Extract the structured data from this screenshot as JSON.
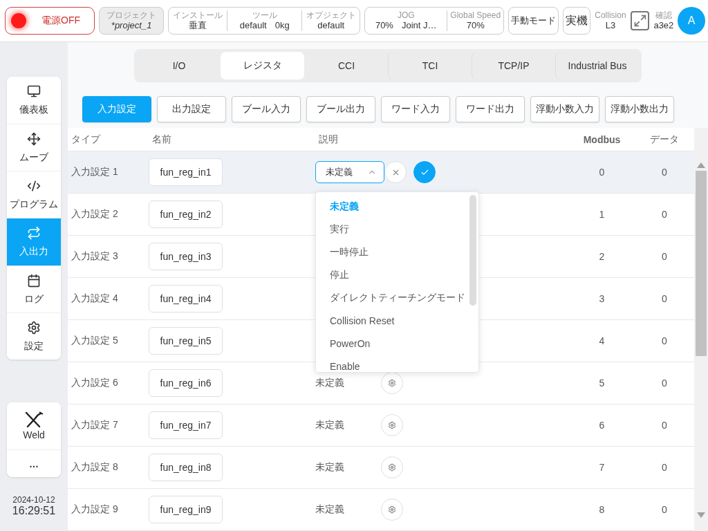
{
  "top_bar": {
    "power": {
      "label": "電源OFF",
      "on": false
    },
    "project": {
      "label": "プロジェクト",
      "value": "*project_1"
    },
    "setup": [
      {
        "label": "インストール",
        "values": [
          "垂直"
        ]
      },
      {
        "label": "ツール",
        "values": [
          "default",
          "0kg"
        ]
      },
      {
        "label": "オブジェクト",
        "values": [
          "default"
        ]
      }
    ],
    "speed": [
      {
        "label": "JOG",
        "values": [
          "70%",
          "Joint J…"
        ]
      },
      {
        "label": "Global Speed",
        "values": [
          "70%"
        ]
      }
    ],
    "buttons": [
      "手動モード",
      "実機"
    ],
    "collision": {
      "label": "Collision",
      "value": "L3"
    },
    "confirm": {
      "label": "確認",
      "value": "a3e2"
    },
    "avatar": "A"
  },
  "sidebar": {
    "items": [
      {
        "label": "儀表板",
        "selected": false
      },
      {
        "label": "ムーブ",
        "selected": false
      },
      {
        "label": "プログラム",
        "selected": false
      },
      {
        "label": "入出力",
        "selected": true
      },
      {
        "label": "ログ",
        "selected": false
      },
      {
        "label": "設定",
        "selected": false
      }
    ],
    "extras": [
      {
        "label": "Weld",
        "kind": "weld"
      },
      {
        "label": "…",
        "kind": "more"
      }
    ],
    "date": "2024-10-12",
    "time": "16:29:51"
  },
  "tabs": [
    {
      "label": "I/O",
      "selected": false
    },
    {
      "label": "レジスタ",
      "selected": true
    },
    {
      "label": "CCI",
      "selected": false
    },
    {
      "label": "TCI",
      "selected": false
    },
    {
      "label": "TCP/IP",
      "selected": false
    },
    {
      "label": "Industrial Bus",
      "selected": false
    }
  ],
  "sub_tabs": [
    {
      "label": "入力設定",
      "selected": true
    },
    {
      "label": "出力設定",
      "selected": false
    },
    {
      "label": "ブール入力",
      "selected": false
    },
    {
      "label": "ブール出力",
      "selected": false
    },
    {
      "label": "ワード入力",
      "selected": false
    },
    {
      "label": "ワード出力",
      "selected": false
    },
    {
      "label": "浮動小数入力",
      "selected": false
    },
    {
      "label": "浮動小数出力",
      "selected": false
    }
  ],
  "table": {
    "columns": [
      "タイプ",
      "名前",
      "説明",
      "Modbus",
      "データ"
    ],
    "rows": [
      {
        "type": "入力設定 1",
        "name": "fun_reg_in1",
        "description": "未定義",
        "selected": true,
        "modbus": "0",
        "data": "0"
      },
      {
        "type": "入力設定 2",
        "name": "fun_reg_in2",
        "selected": false,
        "modbus": "1",
        "data": "0"
      },
      {
        "type": "入力設定 3",
        "name": "fun_reg_in3",
        "selected": false,
        "modbus": "2",
        "data": "0"
      },
      {
        "type": "入力設定 4",
        "name": "fun_reg_in4",
        "selected": false,
        "modbus": "3",
        "data": "0"
      },
      {
        "type": "入力設定 5",
        "name": "fun_reg_in5",
        "selected": false,
        "modbus": "4",
        "data": "0"
      },
      {
        "type": "入力設定 6",
        "name": "fun_reg_in6",
        "description": "未定義",
        "selected": false,
        "modbus": "5",
        "data": "0"
      },
      {
        "type": "入力設定 7",
        "name": "fun_reg_in7",
        "description": "未定義",
        "selected": false,
        "modbus": "6",
        "data": "0"
      },
      {
        "type": "入力設定 8",
        "name": "fun_reg_in8",
        "description": "未定義",
        "selected": false,
        "modbus": "7",
        "data": "0"
      },
      {
        "type": "入力設定 9",
        "name": "fun_reg_in9",
        "description": "未定義",
        "selected": false,
        "modbus": "8",
        "data": "0"
      }
    ]
  },
  "dropdown": {
    "options": [
      {
        "label": "未定義",
        "selected": true
      },
      {
        "label": "実行",
        "selected": false
      },
      {
        "label": "一時停止",
        "selected": false
      },
      {
        "label": "停止",
        "selected": false
      },
      {
        "label": "ダイレクトティーチングモード",
        "selected": false
      },
      {
        "label": "Collision Reset",
        "selected": false
      },
      {
        "label": "PowerOn",
        "selected": false
      },
      {
        "label": "Enable",
        "selected": false
      }
    ]
  }
}
